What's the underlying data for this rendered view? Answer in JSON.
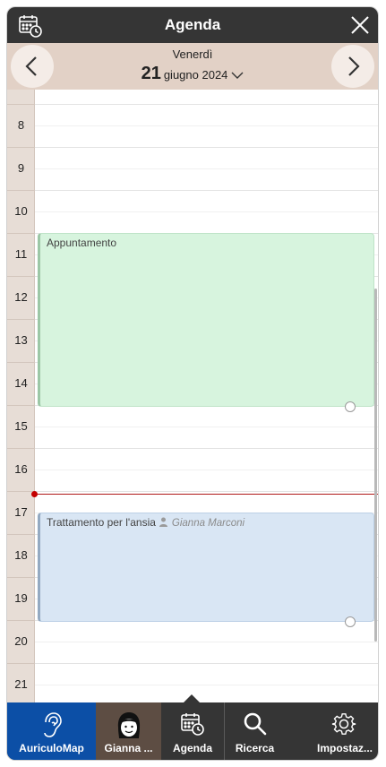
{
  "header": {
    "title": "Agenda",
    "left_icon": "calendar-clock-icon",
    "right_icon": "close-icon"
  },
  "date_bar": {
    "weekday": "Venerdì",
    "day": "21",
    "month_year": "giugno 2024",
    "prev_icon": "chevron-left-icon",
    "next_icon": "chevron-right-icon",
    "dropdown_icon": "chevron-down-icon"
  },
  "hours": [
    "8",
    "9",
    "10",
    "11",
    "12",
    "13",
    "14",
    "15",
    "16",
    "17",
    "18",
    "19",
    "20",
    "21"
  ],
  "events": [
    {
      "title": "Appuntamento",
      "patient": "",
      "color": "#d7f4de"
    },
    {
      "title": "Trattamento per l'ansia",
      "patient": "Gianna Marconi",
      "color": "#d9e6f4"
    }
  ],
  "current_time_color": "#c40000",
  "tabs": [
    {
      "label": "AuriculoMap",
      "icon": "ear-icon",
      "color": "#0c4fa6"
    },
    {
      "label": "Gianna ...",
      "icon": "avatar-icon",
      "color": "#5d4d43"
    },
    {
      "label": "Agenda",
      "icon": "calendar-clock-icon"
    },
    {
      "label": "Ricerca",
      "icon": "search-icon"
    },
    {
      "label": "Impostaz...",
      "icon": "gear-icon"
    }
  ]
}
